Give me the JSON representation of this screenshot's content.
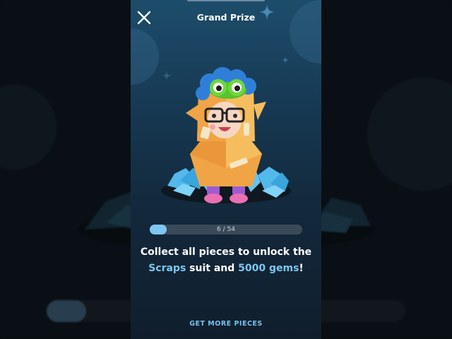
{
  "header": {
    "title": "Grand Prize",
    "close_icon": "close-icon"
  },
  "prize": {
    "progress_text": "6 / 54",
    "progress_fraction": 0.111
  },
  "description": {
    "part1": "Collect all pieces to unlock the",
    "suit_name": "Scraps",
    "part2": " suit and ",
    "gems": "5000 gems",
    "part3": "!"
  },
  "actions": {
    "get_more_label": "GET MORE PIECES"
  },
  "colors": {
    "accent": "#7ec7f0",
    "panel_top": "#1d4d6b",
    "panel_bottom": "#101e2c"
  }
}
